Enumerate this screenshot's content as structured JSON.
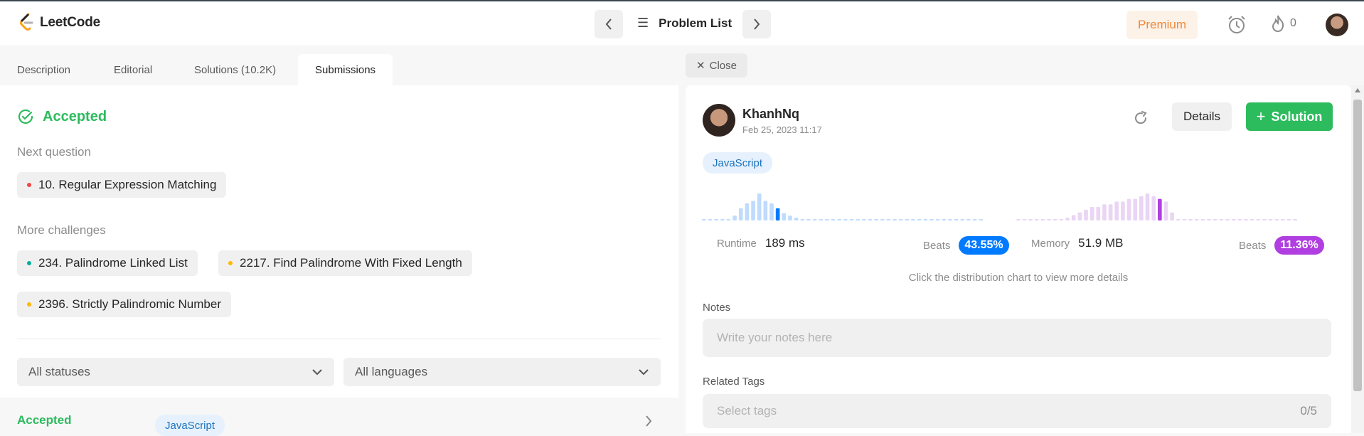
{
  "header": {
    "logo_text": "LeetCode",
    "problem_list_label": "Problem List",
    "premium_label": "Premium",
    "streak_count": "0",
    "icons": [
      "leetcode-logo-icon",
      "chevron-left-icon",
      "chevron-right-icon",
      "list-icon",
      "alarm-clock-icon",
      "fire-icon",
      "user-avatar"
    ]
  },
  "tabs": [
    "Description",
    "Editorial",
    "Solutions (10.2K)",
    "Submissions"
  ],
  "active_tab": "Submissions",
  "result": {
    "status": "Accepted",
    "next_question_label": "Next question",
    "next_question": "10. Regular Expression Matching",
    "more_challenges_label": "More challenges",
    "challenges": [
      {
        "title": "234. Palindrome Linked List",
        "difficulty_color": "#00af9b"
      },
      {
        "title": "2217. Find Palindrome With Fixed Length",
        "difficulty_color": "#ffb800"
      },
      {
        "title": "2396. Strictly Palindromic Number",
        "difficulty_color": "#ffb800"
      }
    ],
    "next_question_color": "#ef4743"
  },
  "filters": {
    "status_select": "All statuses",
    "language_select": "All languages"
  },
  "submission_row": {
    "status": "Accepted",
    "language": "JavaScript"
  },
  "detail": {
    "close_label": "Close",
    "user_name": "KhanhNq",
    "date": "Feb 25, 2023 11:17",
    "details_label": "Details",
    "solution_label": "Solution",
    "language": "JavaScript",
    "runtime_label": "Runtime",
    "runtime_value": "189 ms",
    "runtime_beats_label": "Beats",
    "runtime_beats": "43.55%",
    "memory_label": "Memory",
    "memory_value": "51.9 MB",
    "memory_beats_label": "Beats",
    "memory_beats": "11.36%",
    "hint": "Click the distribution chart to view more details",
    "notes_label": "Notes",
    "notes_placeholder": "Write your notes here",
    "tags_label": "Related Tags",
    "tags_placeholder": "Select tags",
    "tags_count": "0/5"
  },
  "colors": {
    "accent_green": "#2cbb5d",
    "runtime_blue": "#007aff",
    "memory_purple": "#b03ee0",
    "premium_orange": "#f0883a"
  },
  "chart_data": [
    {
      "type": "bar",
      "name": "runtime-distribution",
      "values": [
        0,
        0,
        0,
        0,
        0,
        2,
        5,
        7,
        8,
        11,
        8,
        7,
        5,
        3,
        2,
        1,
        0,
        0,
        0,
        0,
        0,
        0,
        0,
        0,
        0,
        0,
        0,
        0,
        0,
        0,
        0,
        0,
        0,
        0,
        0,
        0,
        0,
        0,
        0,
        0,
        0,
        0,
        0,
        0,
        0,
        0
      ],
      "highlight_index": 12
    },
    {
      "type": "bar",
      "name": "memory-distribution",
      "values": [
        0,
        0,
        0,
        0,
        0,
        0,
        0,
        0,
        1,
        2,
        3,
        4,
        5,
        5,
        6,
        6,
        7,
        7,
        8,
        8,
        9,
        10,
        9,
        8,
        7,
        3,
        0,
        0,
        0,
        0,
        0,
        0,
        0,
        0,
        0,
        0,
        0,
        0,
        0,
        0,
        0,
        0,
        0,
        0,
        0,
        0
      ],
      "highlight_index": 23
    }
  ]
}
